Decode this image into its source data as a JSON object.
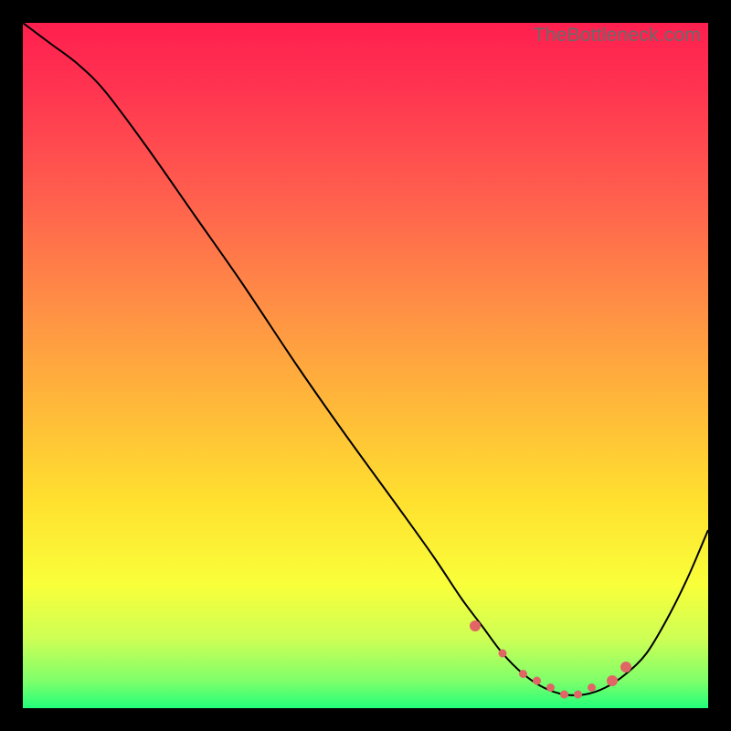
{
  "watermark": "TheBottleneck.com",
  "gradient_stops": [
    {
      "offset": "0%",
      "color": "#ff1f4f"
    },
    {
      "offset": "10%",
      "color": "#ff3550"
    },
    {
      "offset": "25%",
      "color": "#ff5e4e"
    },
    {
      "offset": "40%",
      "color": "#ff8b46"
    },
    {
      "offset": "55%",
      "color": "#ffb63a"
    },
    {
      "offset": "70%",
      "color": "#ffe12f"
    },
    {
      "offset": "82%",
      "color": "#f9ff3a"
    },
    {
      "offset": "90%",
      "color": "#ccff55"
    },
    {
      "offset": "96%",
      "color": "#7fff6a"
    },
    {
      "offset": "100%",
      "color": "#22ff7a"
    }
  ],
  "curve_color": "#000000",
  "curve_width": 2.0,
  "marker_color": "#e06666",
  "marker_radius_major": 6,
  "marker_radius_minor": 4.5,
  "chart_data": {
    "type": "line",
    "title": "",
    "xlabel": "",
    "ylabel": "",
    "xlim": [
      0,
      100
    ],
    "ylim": [
      0,
      100
    ],
    "grid": false,
    "note": "Axes are normalized across the plotting area; y=0 at the bottom (green) edge, y=100 at the top.",
    "series": [
      {
        "name": "bottleneck-curve",
        "x": [
          0,
          4,
          8,
          12,
          18,
          25,
          32,
          40,
          47,
          55,
          60,
          64,
          67,
          70,
          73,
          76,
          79,
          82,
          85,
          88,
          91,
          94,
          97,
          100
        ],
        "y": [
          100,
          97,
          94,
          90,
          82,
          72,
          62,
          50,
          40,
          29,
          22,
          16,
          12,
          8,
          5,
          3,
          2,
          2,
          3,
          5,
          8,
          13,
          19,
          26
        ]
      }
    ],
    "markers": {
      "name": "optimal-range-markers",
      "x": [
        66,
        70,
        73,
        75,
        77,
        79,
        81,
        83,
        86,
        88
      ],
      "y": [
        12,
        8,
        5,
        4,
        3,
        2,
        2,
        3,
        4,
        6
      ]
    }
  }
}
